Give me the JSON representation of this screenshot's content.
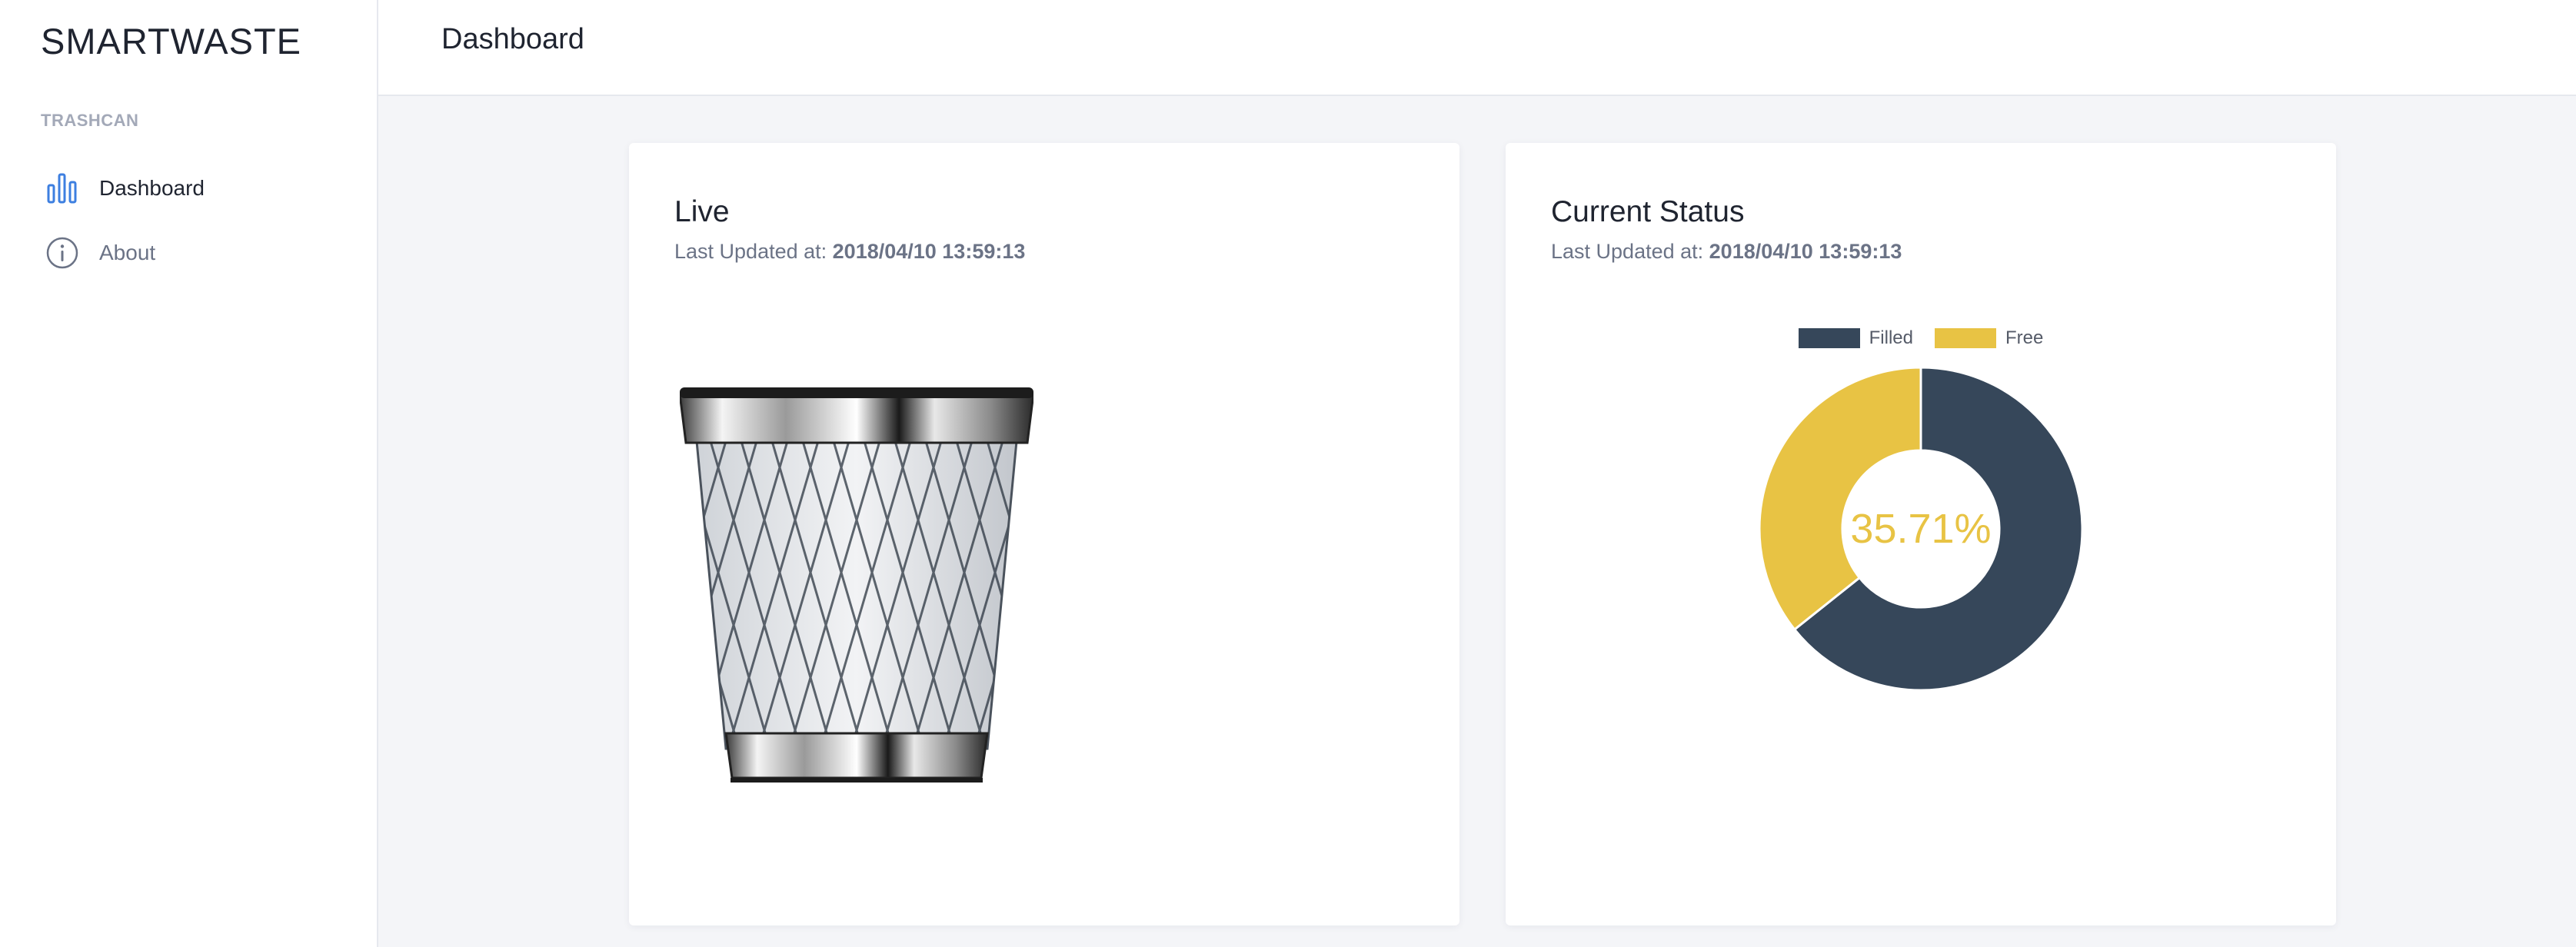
{
  "sidebar": {
    "brand": "SMARTWASTE",
    "section_label": "TRASHCAN",
    "items": [
      {
        "label": "Dashboard",
        "icon": "bar-chart-icon",
        "active": true
      },
      {
        "label": "About",
        "icon": "info-icon",
        "active": false
      }
    ]
  },
  "header": {
    "title": "Dashboard"
  },
  "cards": {
    "live": {
      "title": "Live",
      "updated_prefix": "Last Updated at:",
      "updated_value": "2018/04/10 13:59:13",
      "image": "trash-can-icon"
    },
    "status": {
      "title": "Current Status",
      "updated_prefix": "Last Updated at:",
      "updated_value": "2018/04/10 13:59:13",
      "center_label": "35.71%"
    }
  },
  "colors": {
    "filled": "#36475a",
    "free": "#e8c344",
    "accent": "#3d7fe0"
  },
  "chart_data": {
    "type": "pie",
    "series": [
      {
        "name": "Filled",
        "value": 64.29
      },
      {
        "name": "Free",
        "value": 35.71
      }
    ],
    "legend_position": "top-center",
    "center_text": "35.71%"
  }
}
